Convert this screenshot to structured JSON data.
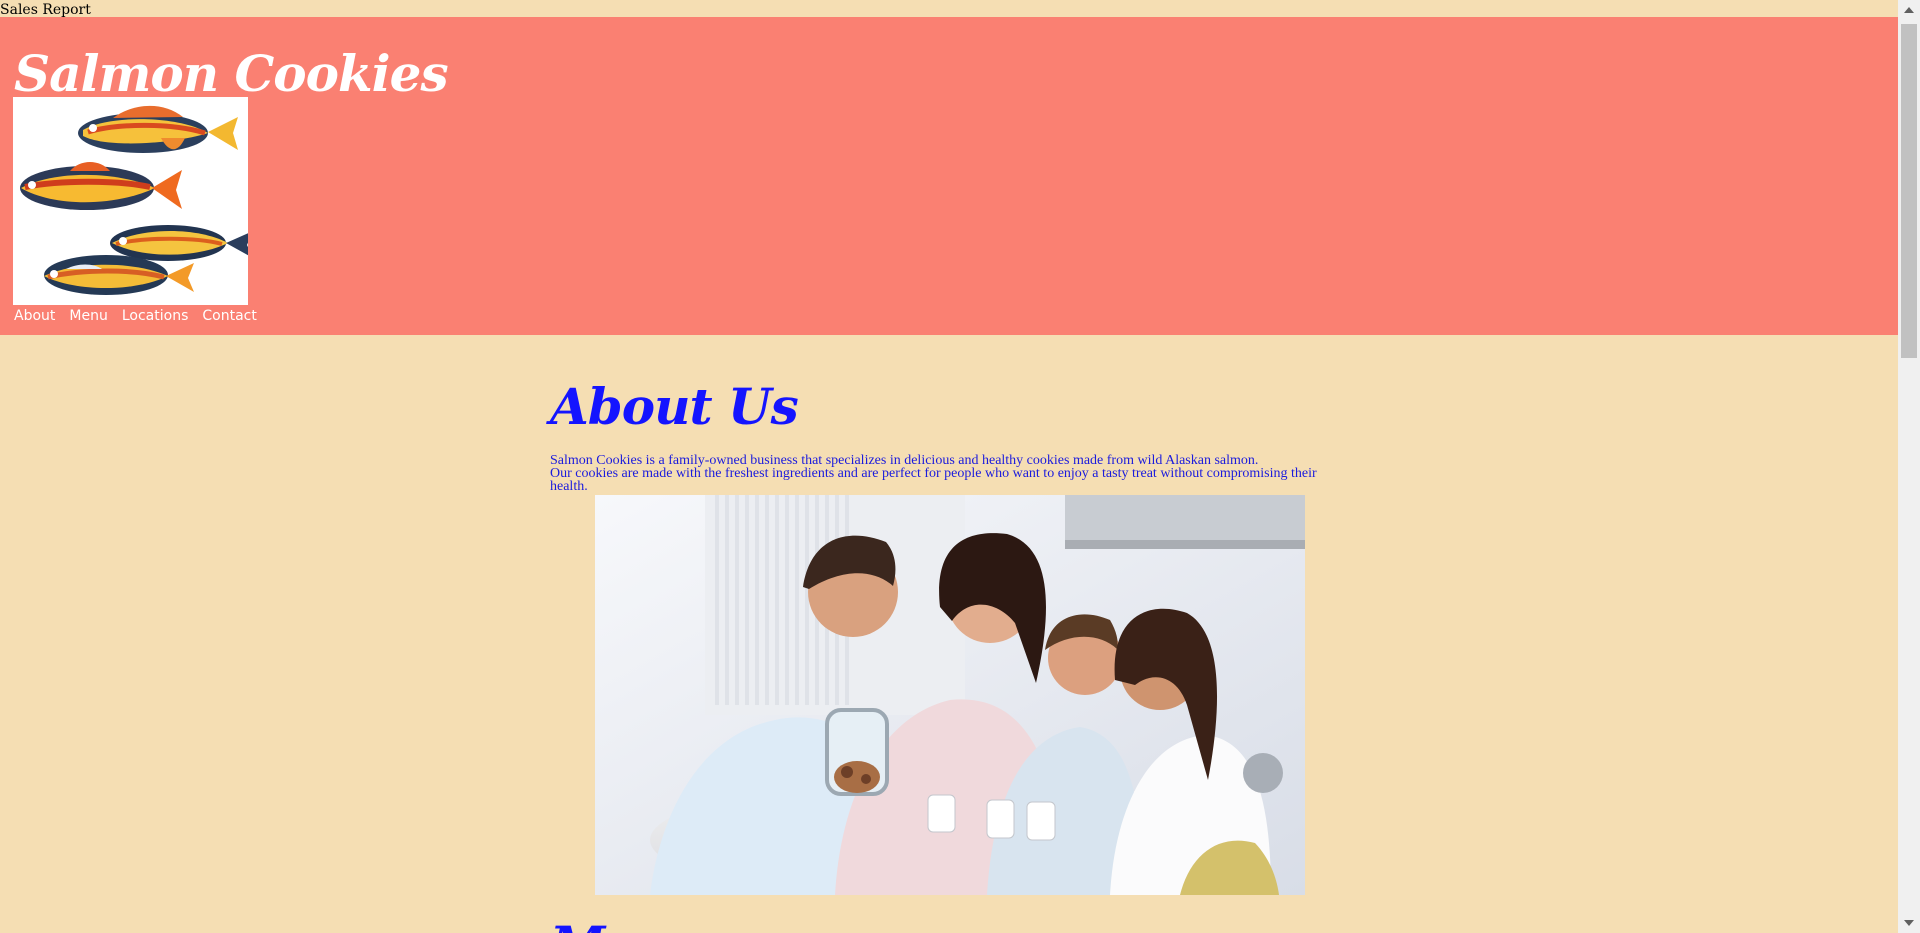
{
  "top_link": "Sales Report",
  "header": {
    "brand": "Salmon Cookies",
    "logo_icon": "salmon-fish-illustration",
    "nav": [
      "About",
      "Menu",
      "Locations",
      "Contact"
    ]
  },
  "about": {
    "title": "About Us",
    "line1": "Salmon Cookies is a family-owned business that specializes in delicious and healthy cookies made from wild Alaskan salmon.",
    "line2": "Our cookies are made with the freshest ingredients and are perfect for people who want to enjoy a tasty treat without compromising their health.",
    "photo_icon": "family-kitchen-photo"
  },
  "next_section_title": "Menu",
  "colors": {
    "background": "#f5deb3",
    "header": "#fa8072",
    "heading": "#1414ff",
    "body_text": "#1b1bdd",
    "nav_text": "#ffffff"
  }
}
